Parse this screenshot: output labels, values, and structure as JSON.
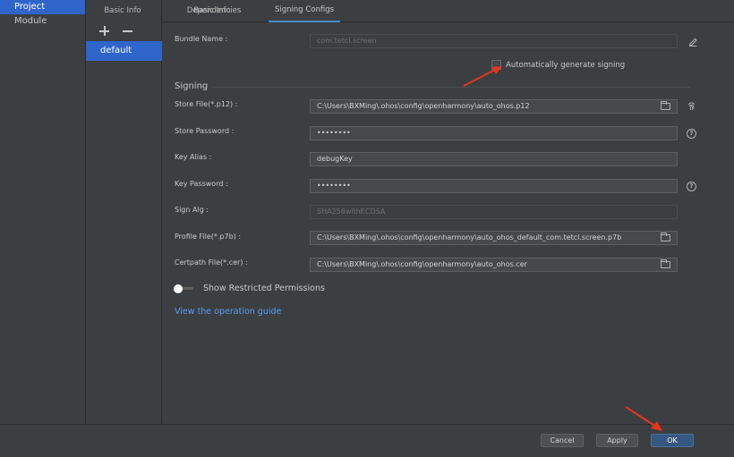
{
  "nav": {
    "items": [
      {
        "label": "Project",
        "active": true
      },
      {
        "label": "Module",
        "active": false
      }
    ]
  },
  "config_list": {
    "add_icon": "plus-icon",
    "remove_icon": "minus-icon",
    "items": [
      "default"
    ]
  },
  "tabs": [
    "Basic Info",
    "Dependencies",
    "Signing Configs"
  ],
  "selected_tab": "Signing Configs",
  "form": {
    "bundle_name": {
      "label": "Bundle Name :",
      "value": "com.tetcl.screen"
    },
    "auto_sign": {
      "label": "Automatically generate signing",
      "checked": false
    },
    "section_title": "Signing",
    "store_file": {
      "label": "Store File(*.p12) :",
      "value": "C:\\Users\\BXMing\\.ohos\\config\\openharmony\\auto_ohos.p12"
    },
    "store_password": {
      "label": "Store Password :",
      "value": "••••••••"
    },
    "key_alias": {
      "label": "Key Alias :",
      "value": "debugKey"
    },
    "key_password": {
      "label": "Key Password :",
      "value": "••••••••"
    },
    "sign_alg": {
      "label": "Sign Alg :",
      "value": "SHA256withECDSA"
    },
    "profile_file": {
      "label": "Profile File(*.p7b) :",
      "value": "C:\\Users\\BXMing\\.ohos\\config\\openharmony\\auto_ohos_default_com.tetcl.screen.p7b"
    },
    "certpath_file": {
      "label": "Certpath File(*.cer) :",
      "value": "C:\\Users\\BXMing\\.ohos\\config\\openharmony\\auto_ohos.cer"
    },
    "restricted": {
      "label": "Show Restricted Permissions",
      "on": false
    },
    "guide_link": "View the operation guide"
  },
  "buttons": {
    "cancel": "Cancel",
    "apply": "Apply",
    "ok": "OK"
  },
  "colors": {
    "accent": "#2f65ca",
    "link": "#589df6",
    "annotation_arrow": "#e8341c",
    "primary_button": "#365880"
  }
}
